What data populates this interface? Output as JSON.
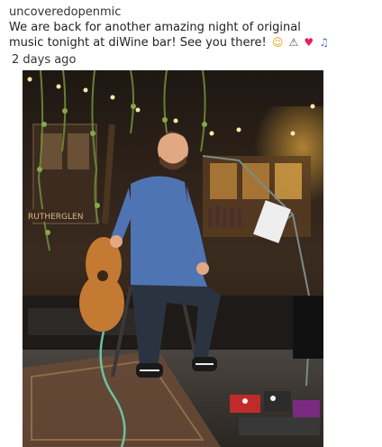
{
  "post": {
    "username": "uncoveredopenmic",
    "caption_line1": "We are back for another amazing night of original",
    "caption_line2": "music tonight at diWine bar! See you there!",
    "emojis": [
      "smiling-face",
      "microphone",
      "red-heart",
      "musical-notes"
    ],
    "timestamp": "2 days ago"
  },
  "photo": {
    "sign_text": "RUTHERGLEN"
  },
  "colors": {
    "shirt": "#4f74b3",
    "jeans": "#2b3340",
    "guitar": "#c47a32",
    "wall": "#2a211a",
    "lights": "#f7e9a8"
  }
}
